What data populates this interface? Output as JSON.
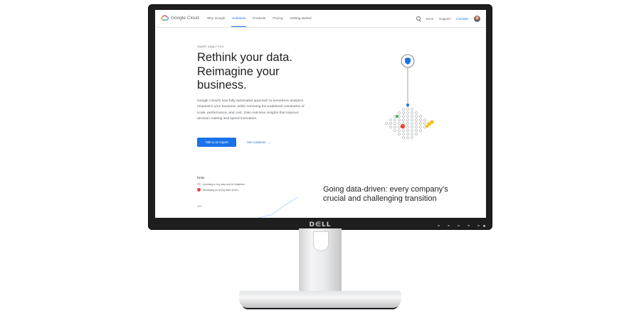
{
  "nav": {
    "brand": "Google Cloud",
    "links": [
      "Why Google",
      "Solutions",
      "Products",
      "Pricing",
      "Getting started"
    ],
    "active_link": "Solutions",
    "right": {
      "docs": "Docs",
      "support": "Support",
      "console": "Console"
    }
  },
  "hero": {
    "eyebrow": "SMART ANALYTICS",
    "title_line1": "Rethink your data.",
    "title_line2": "Reimagine your",
    "title_line3": "business.",
    "body": "Google Cloud's new fully automated approach to serverless analytics empowers your business. while removing the traditional constraints of scale, performance, and cost. Gain real-time insights that improve decision-making and speed innovation.",
    "cta_label": "Talk to an expert",
    "secondary_label": "See solutions",
    "arrow": "→"
  },
  "firms": {
    "label": "Firms",
    "legend": [
      {
        "label": "Investing in big data and AI initiatives",
        "color": "#dadce0"
      },
      {
        "label": "Identifying as being data driven",
        "color": "#ea4335"
      }
    ],
    "axis_label": "40%"
  },
  "section2": {
    "headline": "Going data-driven: every company's crucial and challenging transition"
  },
  "colors": {
    "accent": "#1a73e8",
    "red": "#ea4335",
    "green": "#34a853",
    "yellow": "#fbbc04"
  },
  "icons": {
    "search": "search-icon",
    "shield": "shield-icon",
    "avatar": "avatar"
  }
}
